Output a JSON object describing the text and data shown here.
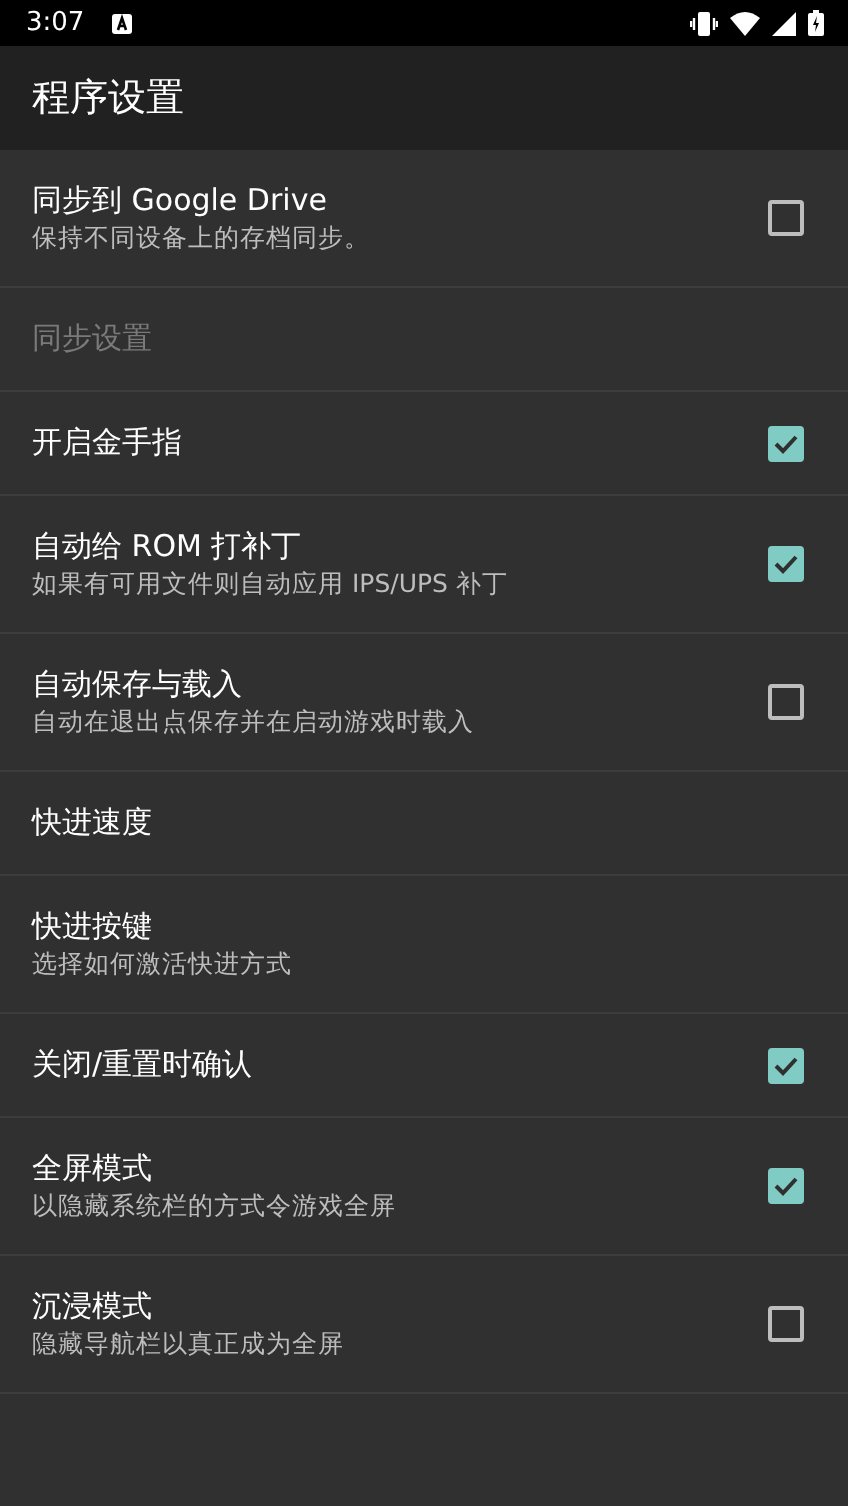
{
  "status_bar": {
    "time": "3:07"
  },
  "app_bar": {
    "title": "程序设置"
  },
  "preferences": [
    {
      "kind": "checkbox",
      "title": "同步到 Google Drive",
      "summary": "保持不同设备上的存档同步。",
      "checked": false
    },
    {
      "kind": "category",
      "title": "同步设置"
    },
    {
      "kind": "checkbox",
      "title": "开启金手指",
      "checked": true
    },
    {
      "kind": "checkbox",
      "title": "自动给 ROM 打补丁",
      "summary": "如果有可用文件则自动应用 IPS/UPS 补丁",
      "checked": true
    },
    {
      "kind": "checkbox",
      "title": "自动保存与载入",
      "summary": "自动在退出点保存并在启动游戏时载入",
      "checked": false
    },
    {
      "kind": "plain",
      "title": "快进速度"
    },
    {
      "kind": "plain",
      "title": "快进按键",
      "summary": "选择如何激活快进方式"
    },
    {
      "kind": "checkbox",
      "title": "关闭/重置时确认",
      "checked": true
    },
    {
      "kind": "checkbox",
      "title": "全屏模式",
      "summary": "以隐藏系统栏的方式令游戏全屏",
      "checked": true
    },
    {
      "kind": "checkbox",
      "title": "沉浸模式",
      "summary": "隐藏导航栏以真正成为全屏",
      "checked": false
    }
  ]
}
